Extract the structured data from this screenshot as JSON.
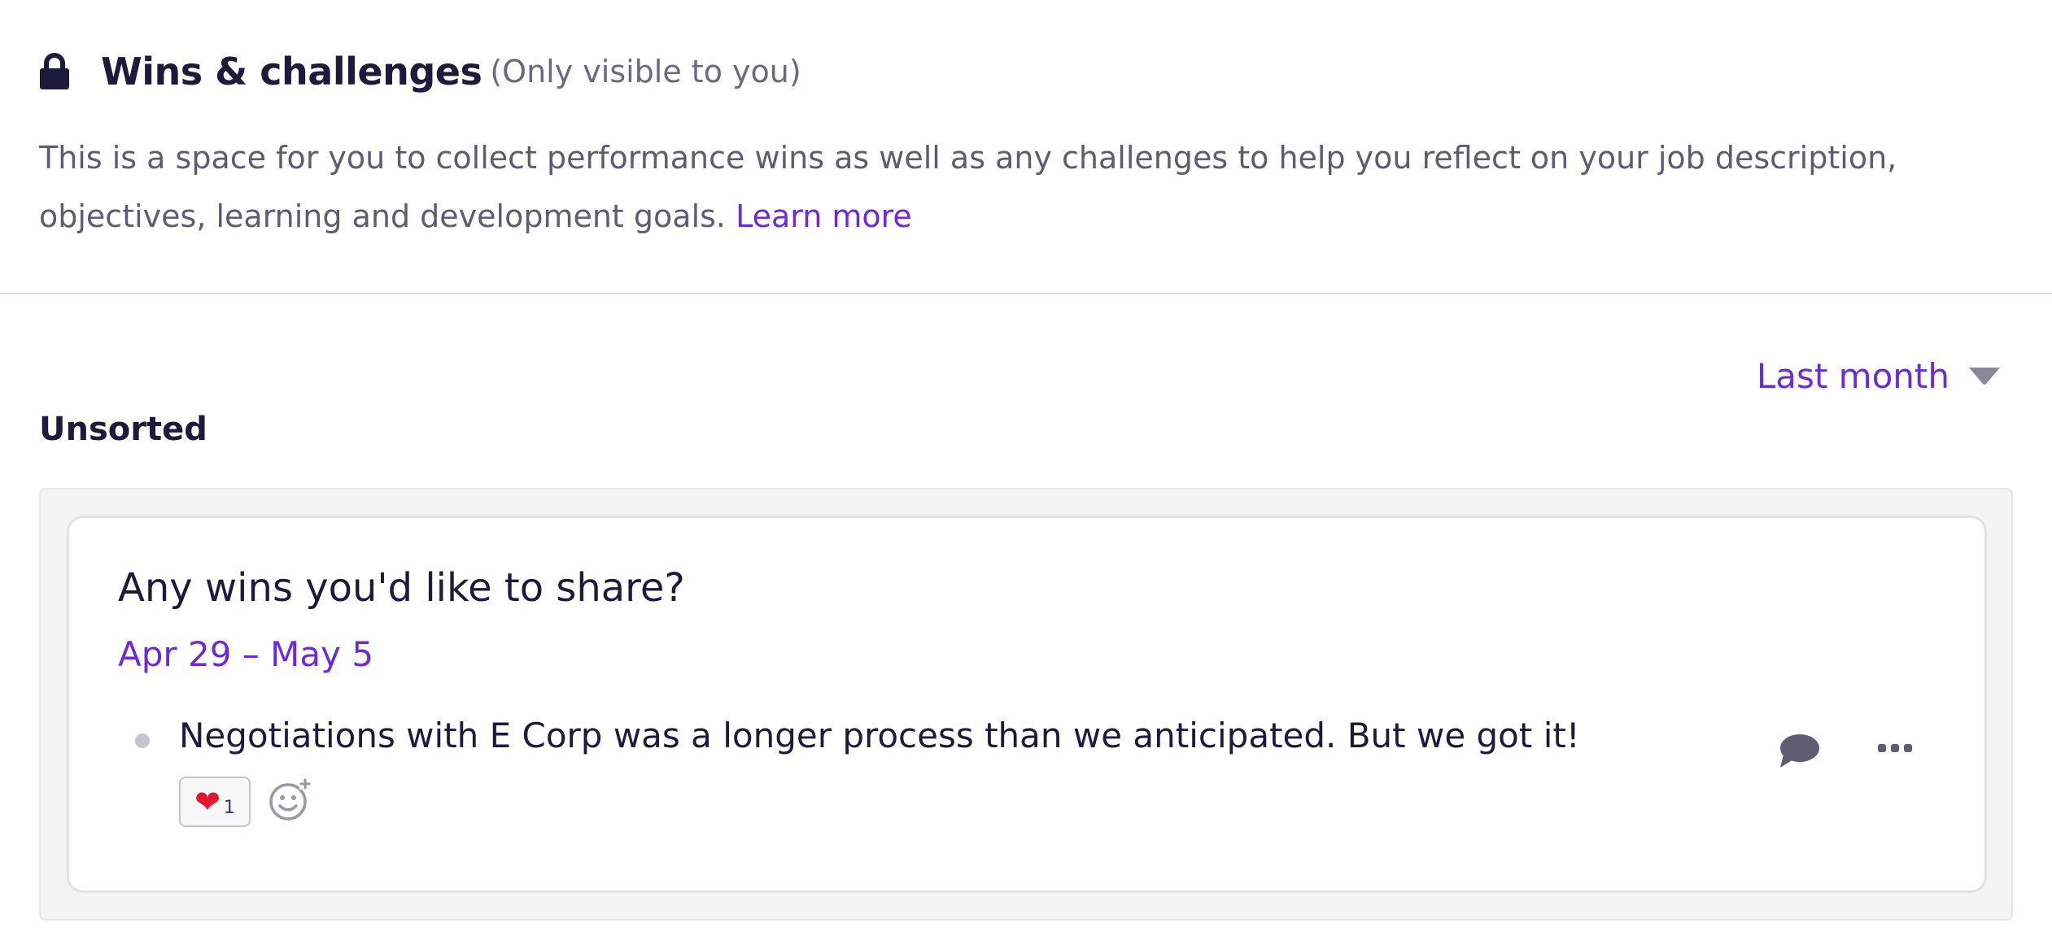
{
  "header": {
    "icon": "lock-icon",
    "title": "Wins & challenges",
    "visibility_note": "(Only visible to you)",
    "description": "This is a space for you to collect performance wins as well as any challenges to help you reflect on your job description, objectives, learning and development goals.",
    "learn_more_label": "Learn more"
  },
  "filter": {
    "selected": "Last month",
    "icon": "caret-down-icon"
  },
  "section": {
    "title": "Unsorted"
  },
  "card": {
    "prompt": "Any wins you'd like to share?",
    "date_range": "Apr 29 – May 5",
    "entries": [
      {
        "text": "Negotiations with E Corp was a longer process than we anticipated. But we got it!",
        "reactions": [
          {
            "emoji": "❤",
            "count": "1"
          }
        ]
      }
    ]
  },
  "colors": {
    "accent": "#6b2bd9",
    "heading": "#1e1a3c",
    "muted": "#5f5b70",
    "panel_bg": "#f4f4f5",
    "heart": "#e0182d"
  }
}
